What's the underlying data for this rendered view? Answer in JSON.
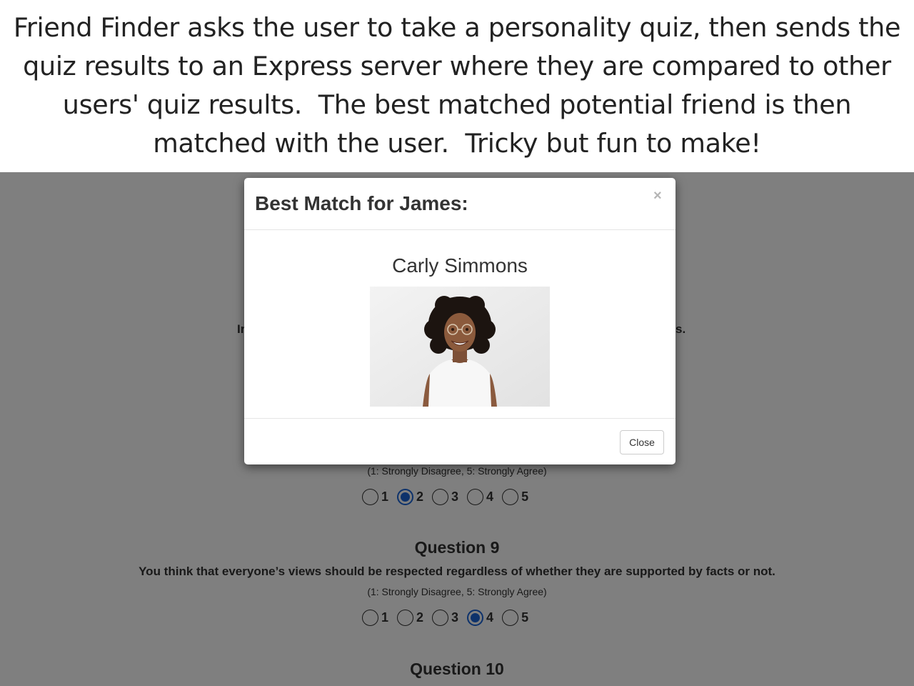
{
  "caption": "Friend Finder asks the user to take a personality quiz, then sends the quiz results to an Express server where they are compared to other users' quiz results.  The best matched potential friend is then matched with the user.  Tricky but fun to make!",
  "page": {
    "intro_left_fragment": "Ir",
    "intro_right_fragment": "s.",
    "questions": [
      {
        "scale_hint": "(1: Strongly Disagree, 5: Strongly Agree)",
        "options": [
          "1",
          "2",
          "3",
          "4",
          "5"
        ],
        "selected": "2"
      },
      {
        "title": "Question 9",
        "text": "You think that everyone’s views should be respected regardless of whether they are supported by facts or not.",
        "scale_hint": "(1: Strongly Disagree, 5: Strongly Agree)",
        "options": [
          "1",
          "2",
          "3",
          "4",
          "5"
        ],
        "selected": "4"
      },
      {
        "title": "Question 10"
      }
    ]
  },
  "modal": {
    "title": "Best Match for James:",
    "close_icon": "×",
    "match_name": "Carly Simmons",
    "close_label": "Close",
    "colors": {
      "radio_checked": "#1a64d6",
      "backdrop": "rgba(0,0,0,0.5)"
    }
  }
}
